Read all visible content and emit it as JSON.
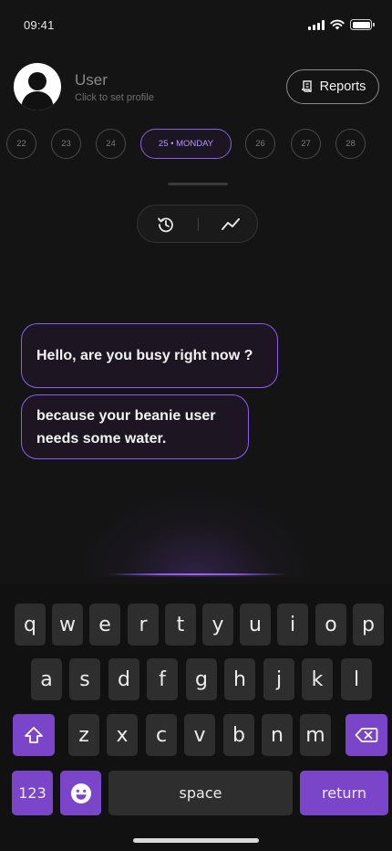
{
  "status_bar": {
    "time": "09:41"
  },
  "profile": {
    "name": "User",
    "subtitle": "Click to set profile"
  },
  "header": {
    "reports_label": "Reports"
  },
  "dates": {
    "items": [
      {
        "label": "22"
      },
      {
        "label": "23"
      },
      {
        "label": "24"
      },
      {
        "label": "25 • MONDAY",
        "active": true
      },
      {
        "label": "26"
      },
      {
        "label": "27"
      },
      {
        "label": "28"
      }
    ]
  },
  "view_toggle": {
    "left_icon": "history-icon",
    "right_icon": "trend-line-icon"
  },
  "messages": [
    {
      "text": "Hello, are you busy right now ?"
    },
    {
      "text": "because your beanie user needs some water."
    }
  ],
  "keyboard": {
    "row1": [
      "q",
      "w",
      "e",
      "r",
      "t",
      "y",
      "u",
      "i",
      "o",
      "p"
    ],
    "row2": [
      "a",
      "s",
      "d",
      "f",
      "g",
      "h",
      "j",
      "k",
      "l"
    ],
    "row3": [
      "z",
      "x",
      "c",
      "v",
      "b",
      "n",
      "m"
    ],
    "numbers_label": "123",
    "space_label": "space",
    "return_label": "return",
    "shift_icon": "shift-icon",
    "delete_icon": "backspace-icon",
    "emoji_icon": "emoji-icon"
  },
  "colors": {
    "accent": "#8b5cf6",
    "background": "#141414",
    "key": "#2e2e2e",
    "key_accent": "#7b45c9"
  }
}
